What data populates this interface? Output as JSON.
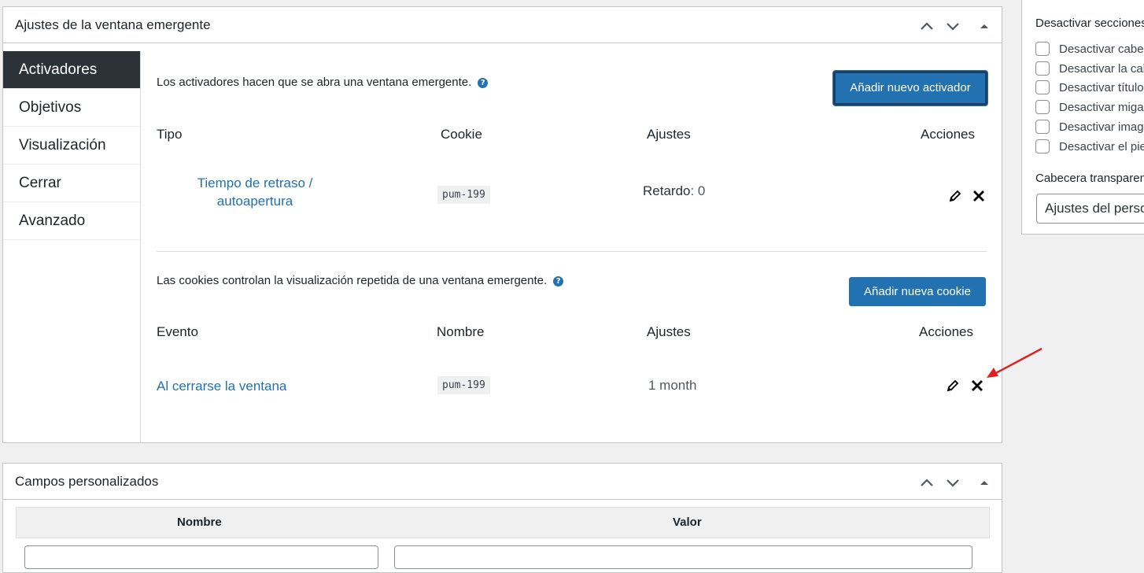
{
  "popup_settings": {
    "title": "Ajustes de la ventana emergente",
    "tabs": [
      "Activadores",
      "Objetivos",
      "Visualización",
      "Cerrar",
      "Avanzado"
    ],
    "triggers": {
      "intro": "Los activadores hacen que se abra una ventana emergente.",
      "help": "?",
      "add_button": "Añadir nuevo activador",
      "headers": {
        "type": "Tipo",
        "cookie": "Cookie",
        "settings": "Ajustes",
        "actions": "Acciones"
      },
      "row": {
        "type_line1": "Tiempo de retraso /",
        "type_line2": "autoapertura",
        "cookie": "pum-199",
        "settings_label": "Retardo",
        "settings_value": ": 0"
      }
    },
    "cookies": {
      "intro": "Las cookies controlan la visualización repetida de una ventana emergente.",
      "help": "?",
      "add_button": "Añadir nueva cookie",
      "headers": {
        "event": "Evento",
        "name": "Nombre",
        "settings": "Ajustes",
        "actions": "Acciones"
      },
      "row": {
        "event": "Al cerrarse la ventana",
        "name": "pum-199",
        "settings": "1 month"
      }
    }
  },
  "custom_fields": {
    "title": "Campos personalizados",
    "headers": {
      "name": "Nombre",
      "value": "Valor"
    }
  },
  "sidebar": {
    "heading": "Desactivar secciones",
    "checkboxes": [
      "Desactivar cabecera",
      "Desactivar la cabecera",
      "Desactivar título",
      "Desactivar migas",
      "Desactivar imagen",
      "Desactivar el pie"
    ],
    "header_transparent_label": "Cabecera transparente",
    "select_value": "Ajustes del personalizador"
  },
  "colors": {
    "accent": "#2271b1",
    "active_tab": "#2c3338",
    "arrow": "#e02020"
  }
}
